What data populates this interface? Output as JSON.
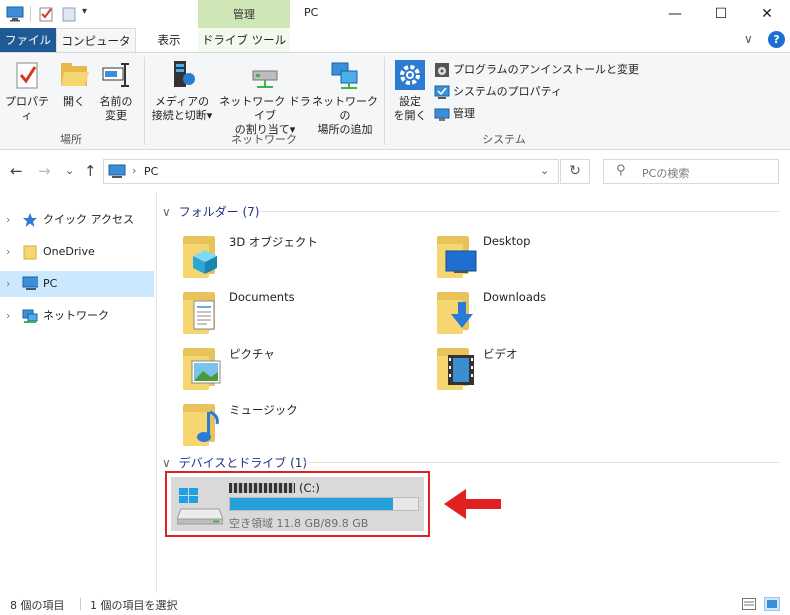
{
  "window": {
    "title": "PC",
    "contextual_tab_header": "管理",
    "controls": {
      "minimize": "—",
      "maximize": "☐",
      "close": "✕"
    }
  },
  "ribbon_tabs": {
    "file": "ファイル",
    "computer": "コンピューター",
    "view": "表示",
    "drive_tools": "ドライブ ツール",
    "collapse": "∨",
    "help": "?"
  },
  "ribbon": {
    "location": {
      "label": "場所",
      "properties": "プロパティ",
      "open": "開く",
      "rename_line1": "名前の",
      "rename_line2": "変更"
    },
    "network": {
      "label": "ネットワーク",
      "media_line1": "メディアの",
      "media_line2": "接続と切断",
      "map_drive_line1": "ネットワーク ドライブ",
      "map_drive_line2": "の割り当て",
      "add_location_line1": "ネットワークの",
      "add_location_line2": "場所の追加",
      "dropdown": "▾"
    },
    "system": {
      "label": "システム",
      "settings_line1": "設定",
      "settings_line2": "を開く",
      "uninstall": "プログラムのアンインストールと変更",
      "system_properties": "システムのプロパティ",
      "manage": "管理"
    }
  },
  "address": {
    "back": "←",
    "forward": "→",
    "recent": "⌄",
    "up": "↑",
    "separator": "›",
    "path": "PC",
    "dropdown": "⌄",
    "refresh": "↻",
    "search_placeholder": "PCの検索",
    "search_icon": "⚲"
  },
  "sidebar": {
    "items": [
      {
        "label": "クイック アクセス",
        "icon": "star-icon"
      },
      {
        "label": "OneDrive",
        "icon": "folder-icon"
      },
      {
        "label": "PC",
        "icon": "computer-icon",
        "selected": true
      },
      {
        "label": "ネットワーク",
        "icon": "network-icon"
      }
    ],
    "chevron": "›"
  },
  "folders": {
    "header": "フォルダー (7)",
    "collapse": "∨",
    "items": [
      {
        "label": "3D オブジェクト",
        "icon": "3d-objects-icon"
      },
      {
        "label": "Desktop",
        "icon": "desktop-icon"
      },
      {
        "label": "Documents",
        "icon": "documents-icon"
      },
      {
        "label": "Downloads",
        "icon": "downloads-icon"
      },
      {
        "label": "ピクチャ",
        "icon": "pictures-icon"
      },
      {
        "label": "ビデオ",
        "icon": "videos-icon"
      },
      {
        "label": "ミュージック",
        "icon": "music-icon"
      }
    ]
  },
  "devices": {
    "header": "デバイスとドライブ (1)",
    "collapse": "∨",
    "drive": {
      "name_suffix": "(C:)",
      "free_space": "空き領域 11.8 GB/89.8 GB",
      "used_fraction": 0.869,
      "bar_color": "#26a0da",
      "highlight_color": "#e02021"
    }
  },
  "status": {
    "item_count": "8 個の項目",
    "selected": "1 個の項目を選択"
  }
}
